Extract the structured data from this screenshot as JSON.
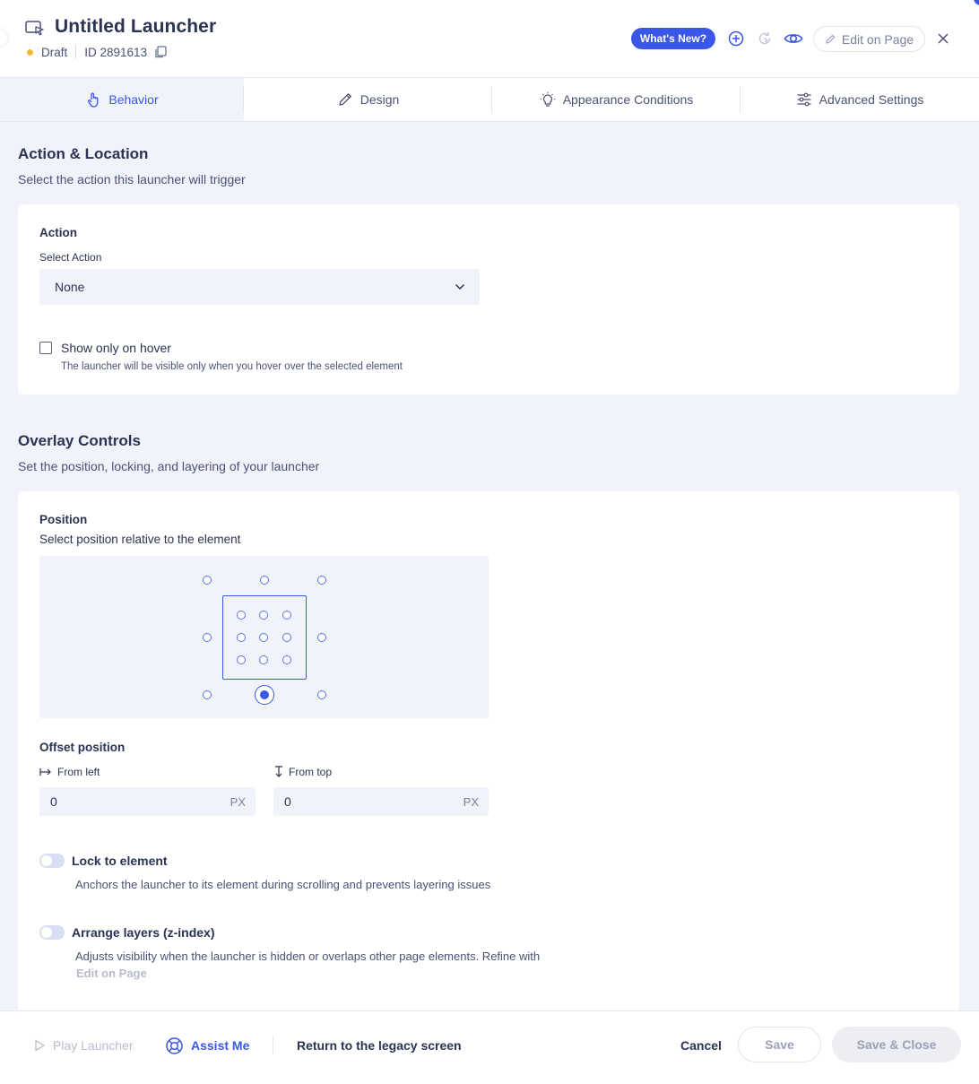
{
  "header": {
    "title": "Untitled Launcher",
    "status": "Draft",
    "id_label": "ID 2891613",
    "whats_new": "What's New?",
    "edit_on_page": "Edit on Page",
    "icons": [
      "launcher-icon",
      "copy-icon",
      "add-circle-icon",
      "refresh-icon",
      "eye-icon",
      "pencil-icon",
      "close-icon"
    ],
    "status_color": "#f5b82e",
    "accent_color": "#3a57e8"
  },
  "tabs": [
    {
      "label": "Behavior",
      "icon": "pointer-hand-icon",
      "active": true
    },
    {
      "label": "Design",
      "icon": "pencil-icon",
      "active": false
    },
    {
      "label": "Appearance Conditions",
      "icon": "lightbulb-icon",
      "active": false
    },
    {
      "label": "Advanced Settings",
      "icon": "sliders-icon",
      "active": false
    }
  ],
  "action_section": {
    "title": "Action & Location",
    "subtitle": "Select the action this launcher will trigger",
    "card": {
      "heading": "Action",
      "select_label": "Select Action",
      "select_value": "None",
      "checkbox_label": "Show only on hover",
      "checkbox_checked": false,
      "checkbox_desc": "The launcher will be visible only when you hover over the selected element"
    }
  },
  "overlay_section": {
    "title": "Overlay Controls",
    "subtitle": "Set the position, locking, and layering of your launcher",
    "card": {
      "position_heading": "Position",
      "position_sub": "Select position relative to the element",
      "selected_position": "bottom-center",
      "offset_heading": "Offset position",
      "from_left_label": "From left",
      "from_left_value": "0",
      "from_top_label": "From top",
      "from_top_value": "0",
      "unit": "PX",
      "lock_label": "Lock to element",
      "lock_on": false,
      "lock_desc": "Anchors the launcher to its element during scrolling and prevents layering issues",
      "layers_label": "Arrange layers (z-index)",
      "layers_on": false,
      "layers_desc": "Adjusts visibility when the launcher is hidden or overlaps other page elements. Refine with",
      "layers_link": "Edit on Page"
    }
  },
  "footer": {
    "play": "Play Launcher",
    "assist": "Assist Me",
    "legacy": "Return to the legacy screen",
    "cancel": "Cancel",
    "save": "Save",
    "save_close": "Save & Close"
  }
}
